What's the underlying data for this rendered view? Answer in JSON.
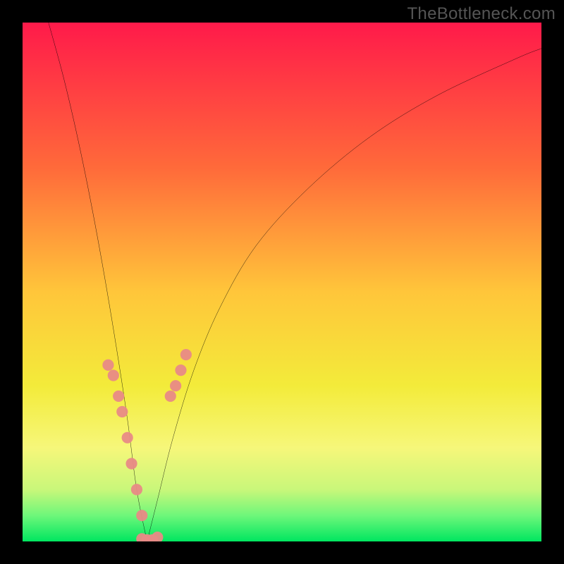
{
  "watermark": "TheBottleneck.com",
  "chart_data": {
    "type": "line",
    "title": "",
    "xlabel": "",
    "ylabel": "",
    "xlim": [
      0,
      100
    ],
    "ylim": [
      0,
      100
    ],
    "grid": false,
    "legend": false,
    "gradient_stops": [
      {
        "pct": 0,
        "color": "#ff1a4a"
      },
      {
        "pct": 28,
        "color": "#ff6a3a"
      },
      {
        "pct": 52,
        "color": "#ffc63a"
      },
      {
        "pct": 70,
        "color": "#f3eb3a"
      },
      {
        "pct": 82,
        "color": "#f6f77a"
      },
      {
        "pct": 90,
        "color": "#c9f77a"
      },
      {
        "pct": 95,
        "color": "#6ef77a"
      },
      {
        "pct": 100,
        "color": "#00e660"
      }
    ],
    "optimal_x": 24,
    "series": [
      {
        "name": "left-curve",
        "x": [
          5,
          8,
          11,
          14,
          17,
          20,
          22,
          24
        ],
        "y": [
          100,
          89,
          76,
          61,
          44,
          25,
          10,
          0
        ]
      },
      {
        "name": "right-curve",
        "x": [
          24,
          26,
          29,
          33,
          38,
          45,
          55,
          67,
          80,
          95,
          100
        ],
        "y": [
          0,
          8,
          20,
          33,
          45,
          57,
          68,
          78,
          86,
          93,
          95
        ]
      },
      {
        "name": "markers-left",
        "type": "scatter",
        "color": "#e88a86",
        "x": [
          16.5,
          17.5,
          18.5,
          19.2,
          20.2,
          21.0,
          22.0,
          23.0
        ],
        "y": [
          34,
          32,
          28,
          25,
          20,
          15,
          10,
          5
        ]
      },
      {
        "name": "markers-right",
        "type": "scatter",
        "color": "#e88a86",
        "x": [
          28.5,
          29.5,
          30.5,
          31.5
        ],
        "y": [
          28,
          30,
          33,
          36
        ]
      },
      {
        "name": "markers-bottom",
        "type": "scatter",
        "color": "#e88a86",
        "x": [
          23.0,
          24.0,
          25.0,
          26.0
        ],
        "y": [
          0.5,
          0.3,
          0.3,
          0.8
        ]
      }
    ]
  }
}
